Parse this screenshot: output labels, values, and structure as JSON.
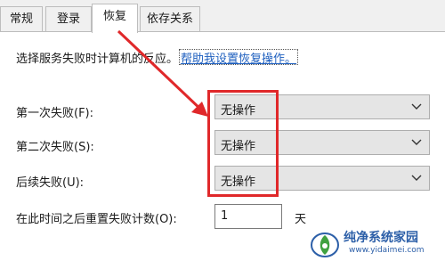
{
  "tabs": [
    {
      "label": "常规"
    },
    {
      "label": "登录"
    },
    {
      "label": "恢复"
    },
    {
      "label": "依存关系"
    }
  ],
  "description": {
    "text": "选择服务失败时计算机的反应。",
    "link": "帮助我设置恢复操作。"
  },
  "rows": [
    {
      "label": "第一次失败(F):",
      "value": "无操作"
    },
    {
      "label": "第二次失败(S):",
      "value": "无操作"
    },
    {
      "label": "后续失败(U):",
      "value": "无操作"
    }
  ],
  "reset": {
    "label": "在此时间之后重置失败计数(O):",
    "value": "1",
    "unit": "天"
  },
  "watermark": {
    "title": "纯净系统家园",
    "url": "www.yidaimei.com"
  },
  "colors": {
    "highlight": "#e0282a",
    "link": "#1e5fbf"
  }
}
